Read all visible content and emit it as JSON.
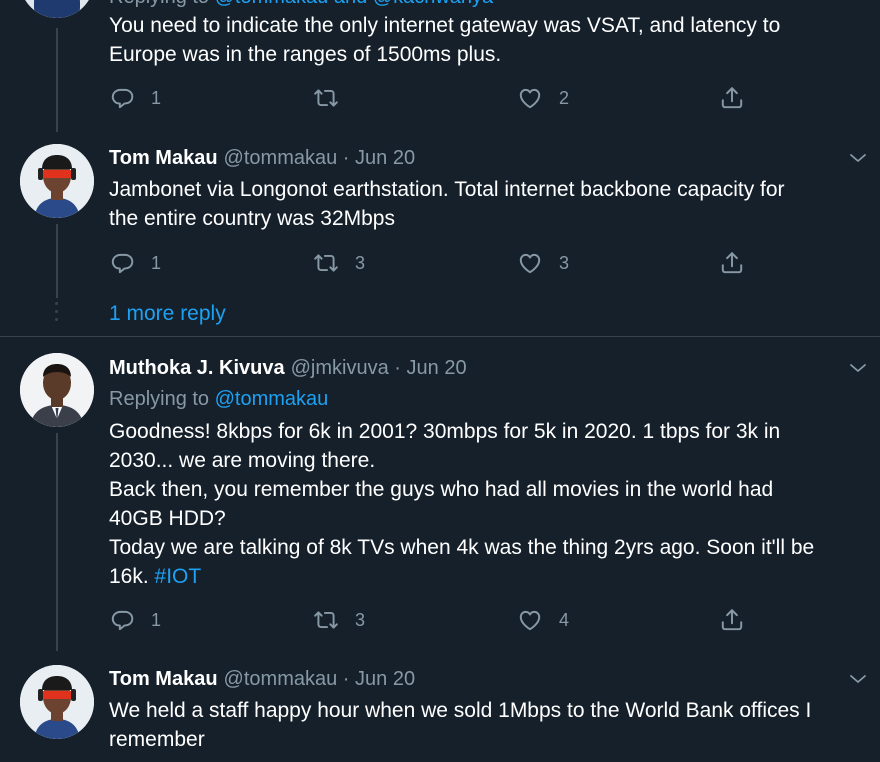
{
  "colors": {
    "background": "#15202b",
    "text": "#ffffff",
    "muted": "#8899a6",
    "link": "#1da1f2",
    "divider": "#38444d"
  },
  "tweet0": {
    "replying_prefix": "Replying to",
    "replying_handles": "@tommakau and @kachwanya",
    "lines": [
      "You need to indicate the only internet gateway was VSAT, and latency to",
      "Europe was in the ranges of 1500ms plus."
    ],
    "actions": {
      "reply": "1",
      "retweet": "",
      "like": "2"
    }
  },
  "tweet1": {
    "name": "Tom Makau",
    "handle": "@tommakau",
    "sep": "·",
    "date": "Jun 20",
    "lines": [
      "Jambonet via Longonot earthstation. Total internet backbone capacity for",
      "the entire country was 32Mbps"
    ],
    "actions": {
      "reply": "1",
      "retweet": "3",
      "like": "3"
    }
  },
  "more_reply": "1 more reply",
  "tweet2": {
    "name": "Muthoka J. Kivuva",
    "handle": "@jmkivuva",
    "sep": "·",
    "date": "Jun 20",
    "replying_prefix": "Replying to",
    "replying_handle": "@tommakau",
    "lines": [
      "Goodness! 8kbps for 6k in 2001? 30mbps for 5k in 2020. 1 tbps for 3k in",
      "2030... we are moving there.",
      "Back then, you remember the guys who had all movies in the world had",
      "40GB HDD?",
      "Today we are talking of 8k TVs when 4k was the thing 2yrs ago. Soon it'll be"
    ],
    "last_line_text": "16k.",
    "hashtag": "#IOT",
    "actions": {
      "reply": "1",
      "retweet": "3",
      "like": "4"
    }
  },
  "tweet3": {
    "name": "Tom Makau",
    "handle": "@tommakau",
    "sep": "·",
    "date": "Jun 20",
    "lines": [
      "We held a staff happy hour when we sold 1Mbps to the World Bank offices I",
      "remember"
    ]
  },
  "icons": [
    "reply-icon",
    "retweet-icon",
    "like-icon",
    "share-icon",
    "chevron-down-icon"
  ]
}
